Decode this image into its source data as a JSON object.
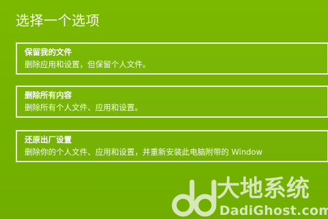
{
  "page": {
    "title": "选择一个选项",
    "background_color": "#78b400",
    "accent_color": "#ffffff"
  },
  "options": [
    {
      "title": "保留我的文件",
      "description": "删除应用和设置，但保留个人文件。"
    },
    {
      "title": "删除所有内容",
      "description": "删除所有个人文件、应用和设置。"
    },
    {
      "title": "还原出厂设置",
      "description": "删除你的个人文件、应用和设置，并重新安装此电脑附带的 Window"
    }
  ],
  "watermark": {
    "logo_icon": "dadighost-logo-icon",
    "cn_text": "大地系统",
    "en_text": "DadiGhost.com"
  }
}
